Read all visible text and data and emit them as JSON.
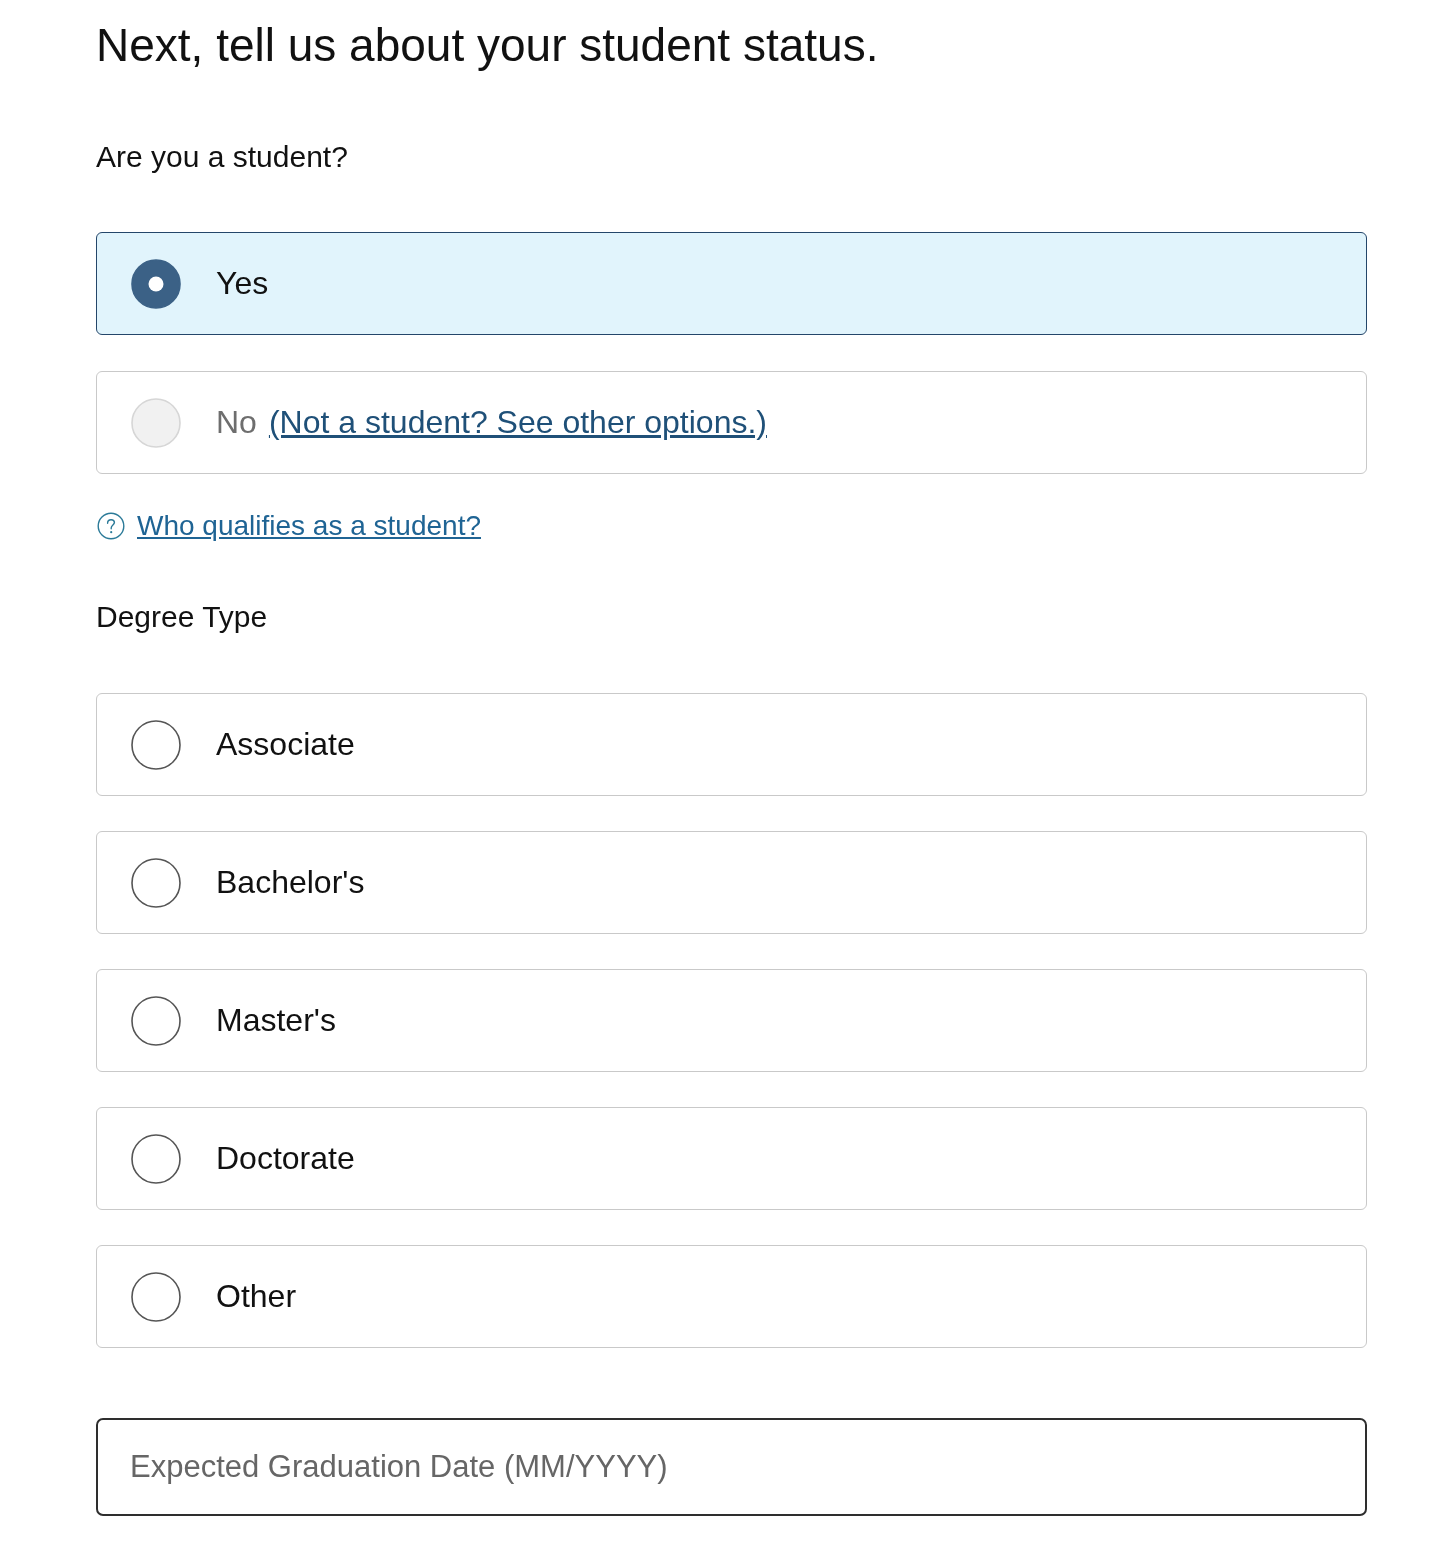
{
  "heading": "Next, tell us about your student status.",
  "student_question": {
    "label": "Are you a student?",
    "options": [
      {
        "label": "Yes",
        "selected": true,
        "disabled": false
      },
      {
        "label": "No",
        "selected": false,
        "disabled": true,
        "link": "(Not a student? See other options.)"
      }
    ]
  },
  "help_link": {
    "text": "Who qualifies as a student?"
  },
  "degree_type": {
    "label": "Degree Type",
    "options": [
      {
        "label": "Associate",
        "selected": false
      },
      {
        "label": "Bachelor's",
        "selected": false
      },
      {
        "label": "Master's",
        "selected": false
      },
      {
        "label": "Doctorate",
        "selected": false
      },
      {
        "label": "Other",
        "selected": false
      }
    ]
  },
  "graduation_date": {
    "placeholder": "Expected Graduation Date (MM/YYYY)"
  }
}
